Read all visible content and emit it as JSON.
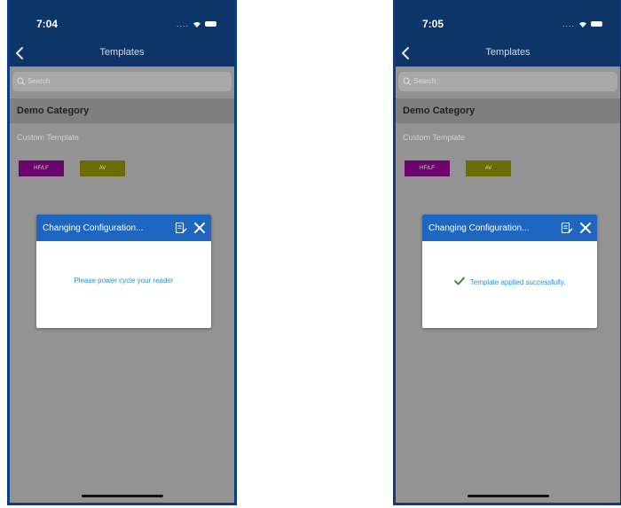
{
  "phones": [
    {
      "time": "7:04",
      "signal_text": "....",
      "nav_title": "Templates",
      "search_placeholder": "Search",
      "category": "Demo Category",
      "template_name": "Custom Template",
      "tags": [
        "HF/LF",
        "AV"
      ],
      "dialog": {
        "title": "Changing Configuration...",
        "message": "Please power cycle your reader",
        "success_check": false
      }
    },
    {
      "time": "7:05",
      "signal_text": "....",
      "nav_title": "Templates",
      "search_placeholder": "Search",
      "category": "Demo Category",
      "template_name": "Custom Template",
      "tags": [
        "HF/LF",
        "AV"
      ],
      "dialog": {
        "title": "Changing Configuration...",
        "message": "Template applied successfully.",
        "success_check": true
      }
    }
  ],
  "colors": {
    "nav_bar": "#0d3568",
    "dialog_header": "#1f66c1",
    "tag_hf": "#6b056b",
    "tag_av": "#6b6b05",
    "message_text": "#2b8fcf",
    "check": "#1a8a2a"
  }
}
